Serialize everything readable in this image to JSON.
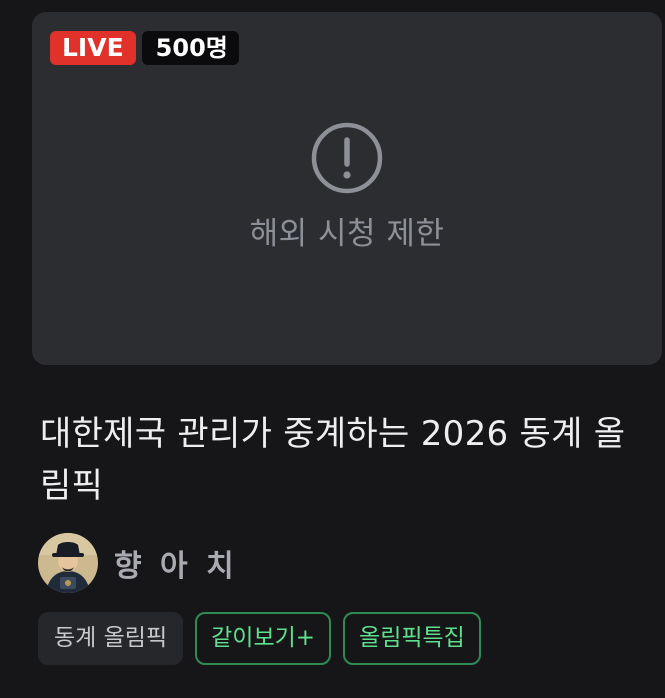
{
  "thumbnail": {
    "live_label": "LIVE",
    "viewers": "500명",
    "restriction_text": "해외 시청 제한",
    "icon": "alert-circle-icon"
  },
  "title": "대한제국 관리가 중계하는 2026 동계 올림픽",
  "channel": {
    "name": "향 아 치",
    "avatar_icon": "avatar"
  },
  "tags": [
    {
      "label": "동계 올림픽",
      "style": "category"
    },
    {
      "label": "같이보기+",
      "style": "highlight"
    },
    {
      "label": "올림픽특집",
      "style": "highlight"
    }
  ],
  "colors": {
    "background": "#161619",
    "thumbnail_bg": "#2c2d31",
    "live_red": "#e0312b",
    "tag_green": "#5fe08e",
    "tag_green_border": "#2f8a55"
  }
}
